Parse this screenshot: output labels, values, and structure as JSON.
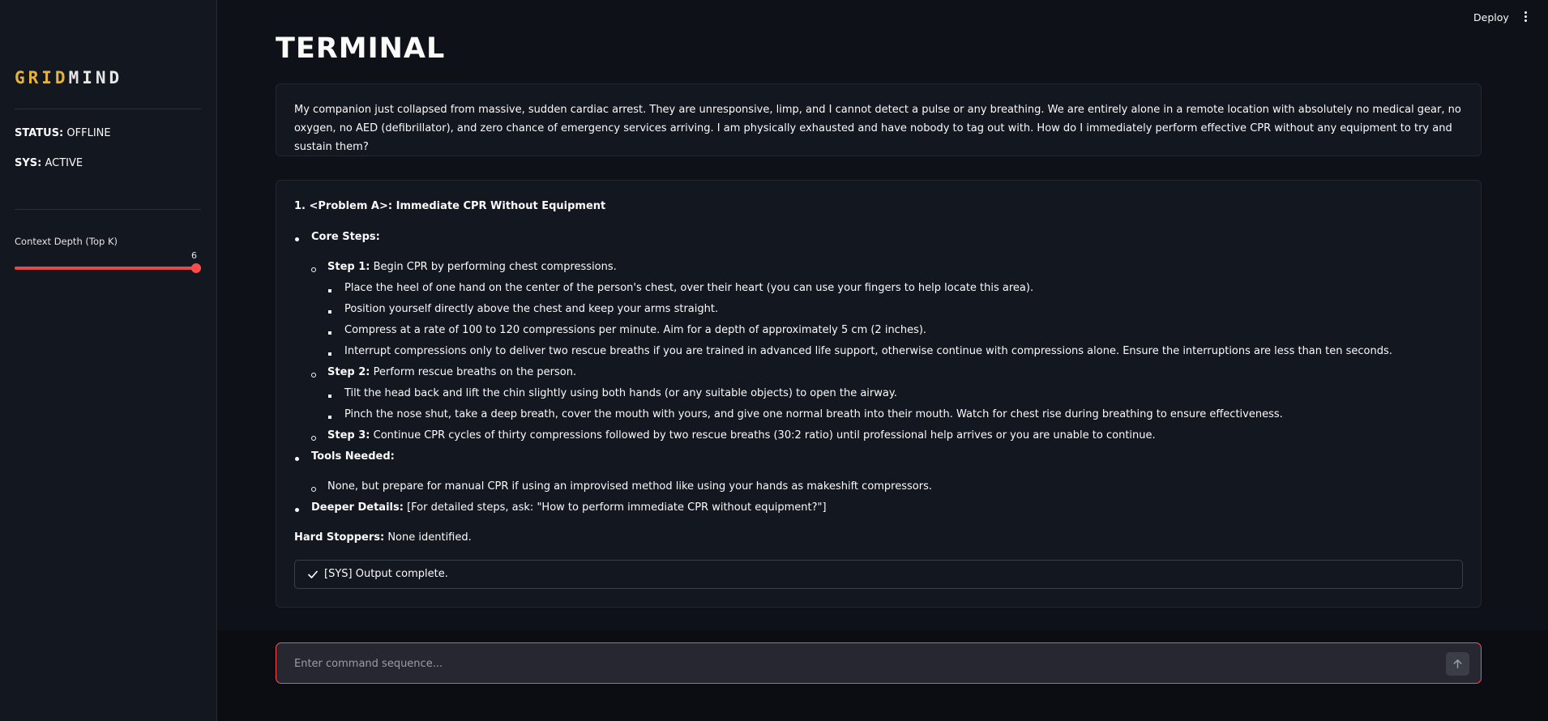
{
  "sidebar": {
    "brand_part1": "GRID",
    "brand_part2": "MIND",
    "status_label": "STATUS:",
    "status_value": "OFFLINE",
    "sys_label": "SYS:",
    "sys_value": "ACTIVE",
    "slider_label": "Context Depth (Top K)",
    "slider_value": "6",
    "slider_fraction": 1.0
  },
  "topbar": {
    "deploy_label": "Deploy",
    "menu_icon": "more-vertical-icon"
  },
  "main": {
    "title": "TERMINAL",
    "user_message": "My companion just collapsed from massive, sudden cardiac arrest. They are unresponsive, limp, and I cannot detect a pulse or any breathing. We are entirely alone in a remote location with absolutely no medical gear, no oxygen, no AED (defibrillator), and zero chance of emergency services arriving. I am physically exhausted and have nobody to tag out with. How do I immediately perform effective CPR without any equipment to try and sustain them?",
    "response": {
      "heading": "1. <Problem A>: Immediate CPR Without Equipment",
      "core_steps_label": "Core Steps:",
      "step1_label": "Step 1:",
      "step1_text": " Begin CPR by performing chest compressions.",
      "step1_items": [
        "Place the heel of one hand on the center of the person's chest, over their heart (you can use your fingers to help locate this area).",
        "Position yourself directly above the chest and keep your arms straight.",
        "Compress at a rate of 100 to 120 compressions per minute. Aim for a depth of approximately 5 cm (2 inches).",
        "Interrupt compressions only to deliver two rescue breaths if you are trained in advanced life support, otherwise continue with compressions alone. Ensure the interruptions are less than ten seconds."
      ],
      "step2_label": "Step 2:",
      "step2_text": " Perform rescue breaths on the person.",
      "step2_items": [
        "Tilt the head back and lift the chin slightly using both hands (or any suitable objects) to open the airway.",
        "Pinch the nose shut, take a deep breath, cover the mouth with yours, and give one normal breath into their mouth. Watch for chest rise during breathing to ensure effectiveness."
      ],
      "step3_label": "Step 3:",
      "step3_text": " Continue CPR cycles of thirty compressions followed by two rescue breaths (30:2 ratio) until professional help arrives or you are unable to continue.",
      "tools_label": "Tools Needed:",
      "tools_item": "None, but prepare for manual CPR if using an improvised method like using your hands as makeshift compressors.",
      "deeper_label": "Deeper Details:",
      "deeper_text": " [For detailed steps, ask: \"How to perform immediate CPR without equipment?\"]",
      "stoppers_label": "Hard Stoppers:",
      "stoppers_text": " None identified.",
      "status_text": "[SYS] Output complete."
    }
  },
  "chat_input": {
    "placeholder": "Enter command sequence...",
    "value": ""
  },
  "colors": {
    "accent": "#ff4b4b",
    "brand_gold": "#e3b341",
    "background": "#0e1117",
    "sidebar": "#131720"
  }
}
